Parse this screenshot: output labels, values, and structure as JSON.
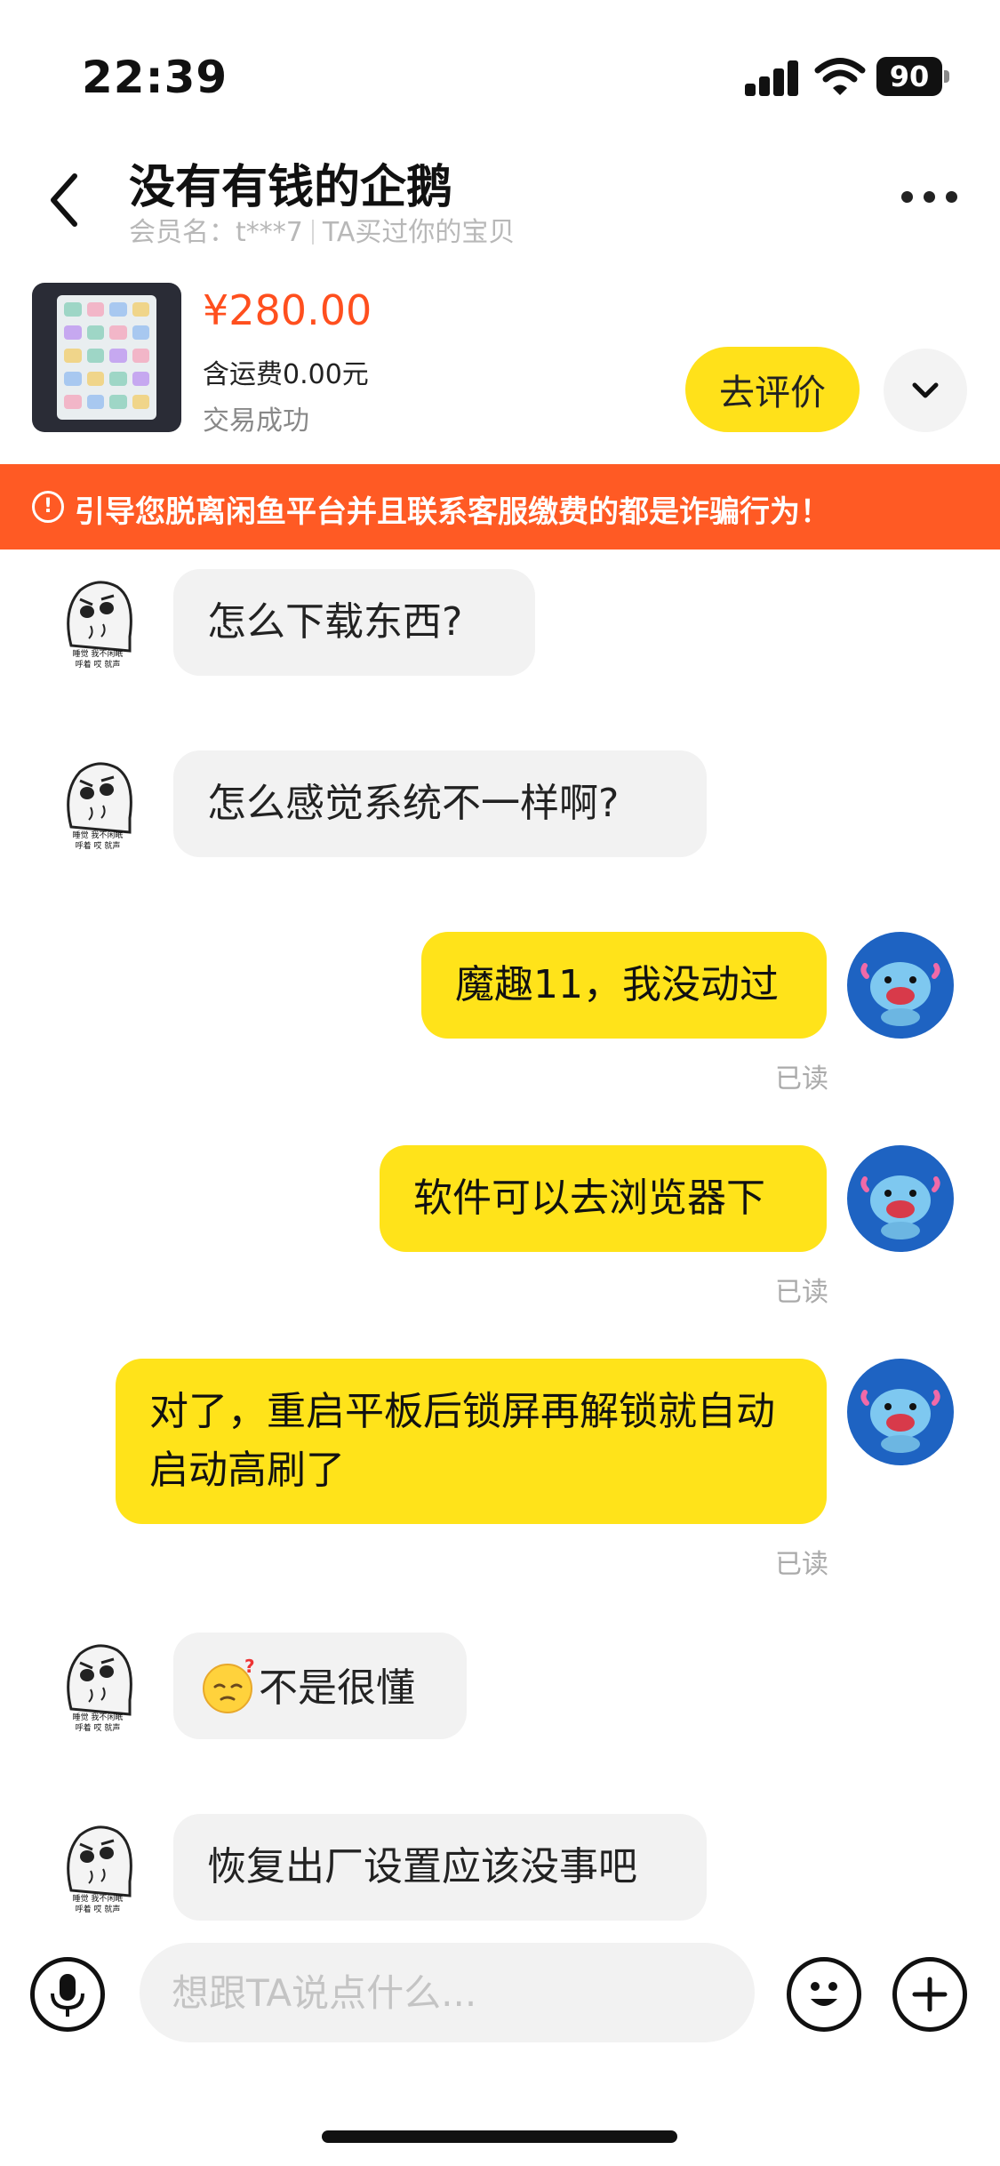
{
  "status_bar": {
    "time": "22:39",
    "battery": "90"
  },
  "header": {
    "title": "没有有钱的企鹅",
    "member": "会员名：t***7",
    "relation": "TA买过你的宝贝"
  },
  "product": {
    "price": "¥280.00",
    "shipping": "含运费0.00元",
    "status": "交易成功",
    "rate_button": "去评价"
  },
  "warning": {
    "text": "引导您脱离闲鱼平台并且联系客服缴费的都是诈骗行为！",
    "icon": "exclamation-circle-icon",
    "color": "#ff5a24"
  },
  "messages": [
    {
      "from": "them",
      "text": "怎么下载东西?"
    },
    {
      "from": "them",
      "text": "怎么感觉系统不一样啊?"
    },
    {
      "from": "me",
      "text": "魔趣11，我没动过",
      "status": "已读"
    },
    {
      "from": "me",
      "text": "软件可以去浏览器下",
      "status": "已读"
    },
    {
      "from": "me",
      "text": "对了，重启平板后锁屏再解锁就自动启动高刷了",
      "status": "已读"
    },
    {
      "from": "them",
      "text": "不是很懂",
      "emoji": "sleepy-face-icon"
    },
    {
      "from": "them",
      "text": "恢复出厂设置应该没事吧"
    }
  ],
  "avatar_sticker_text": [
    "睡觉 我不闲眠",
    "呼着 哎 就声"
  ],
  "input": {
    "placeholder": "想跟TA说点什么..."
  },
  "colors": {
    "accent_yellow": "#ffe31a",
    "price_red": "#ff4f1e",
    "avatar_blue": "#1e63c2"
  }
}
